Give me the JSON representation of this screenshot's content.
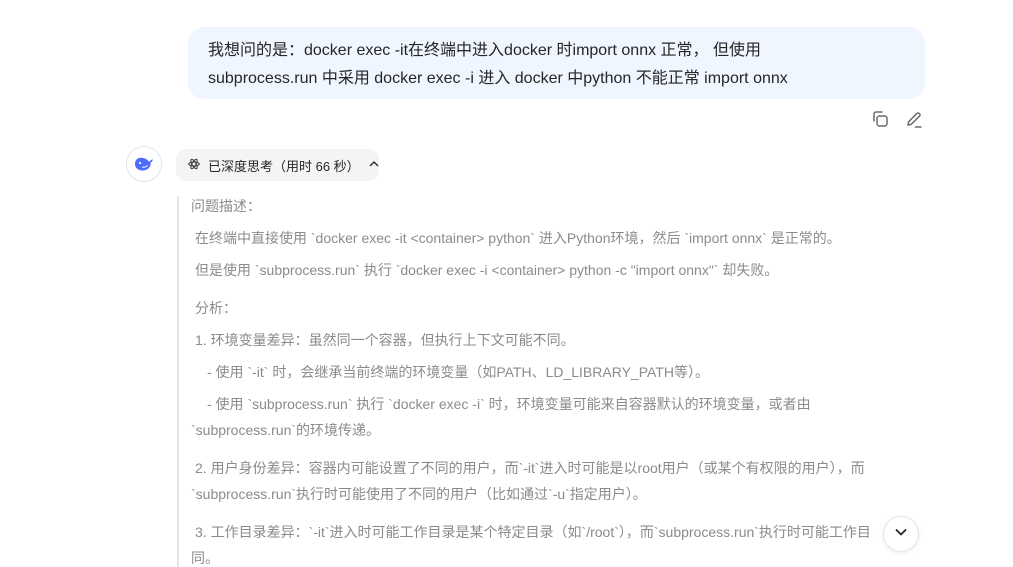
{
  "user_message": {
    "line1": "我想问的是：docker exec -it在终端中进入docker 时import onnx 正常， 但使用",
    "line2": "subprocess.run 中采用 docker exec -i 进入 docker 中python 不能正常 import onnx"
  },
  "message_actions": {
    "copy_icon": "copy-icon",
    "edit_icon": "edit-icon"
  },
  "assistant": {
    "avatar_icon": "whale-logo-icon",
    "think_toggle": {
      "icon": "atom-icon",
      "label": "已深度思考（用时 66 秒）",
      "chevron": "chevron-up-icon"
    },
    "thinking_lines": [
      "问题描述：",
      "在终端中直接使用 `docker exec -it <container> python` 进入Python环境，然后 `import onnx` 是正常的。",
      "但是使用 `subprocess.run` 执行 `docker exec -i <container> python -c \"import onnx\"` 却失败。",
      "分析：",
      "1. 环境变量差异：虽然同一个容器，但执行上下文可能不同。",
      "- 使用 `-it` 时，会继承当前终端的环境变量（如PATH、LD_LIBRARY_PATH等）。",
      "- 使用 `subprocess.run` 执行 `docker exec -i` 时，环境变量可能来自容器默认的环境变量，或者由",
      "`subprocess.run`的环境传递。",
      "2. 用户身份差异：容器内可能设置了不同的用户，而`-it`进入时可能是以root用户（或某个有权限的用户），而",
      "`subprocess.run`执行时可能使用了不同的用户（比如通过`-u`指定用户）。",
      "3. 工作目录差异：`-it`进入时可能工作目录是某个特定目录（如`/root`），而`subprocess.run`执行时可能工作目",
      "同。"
    ]
  },
  "scroll_button_icon": "chevron-down-icon"
}
